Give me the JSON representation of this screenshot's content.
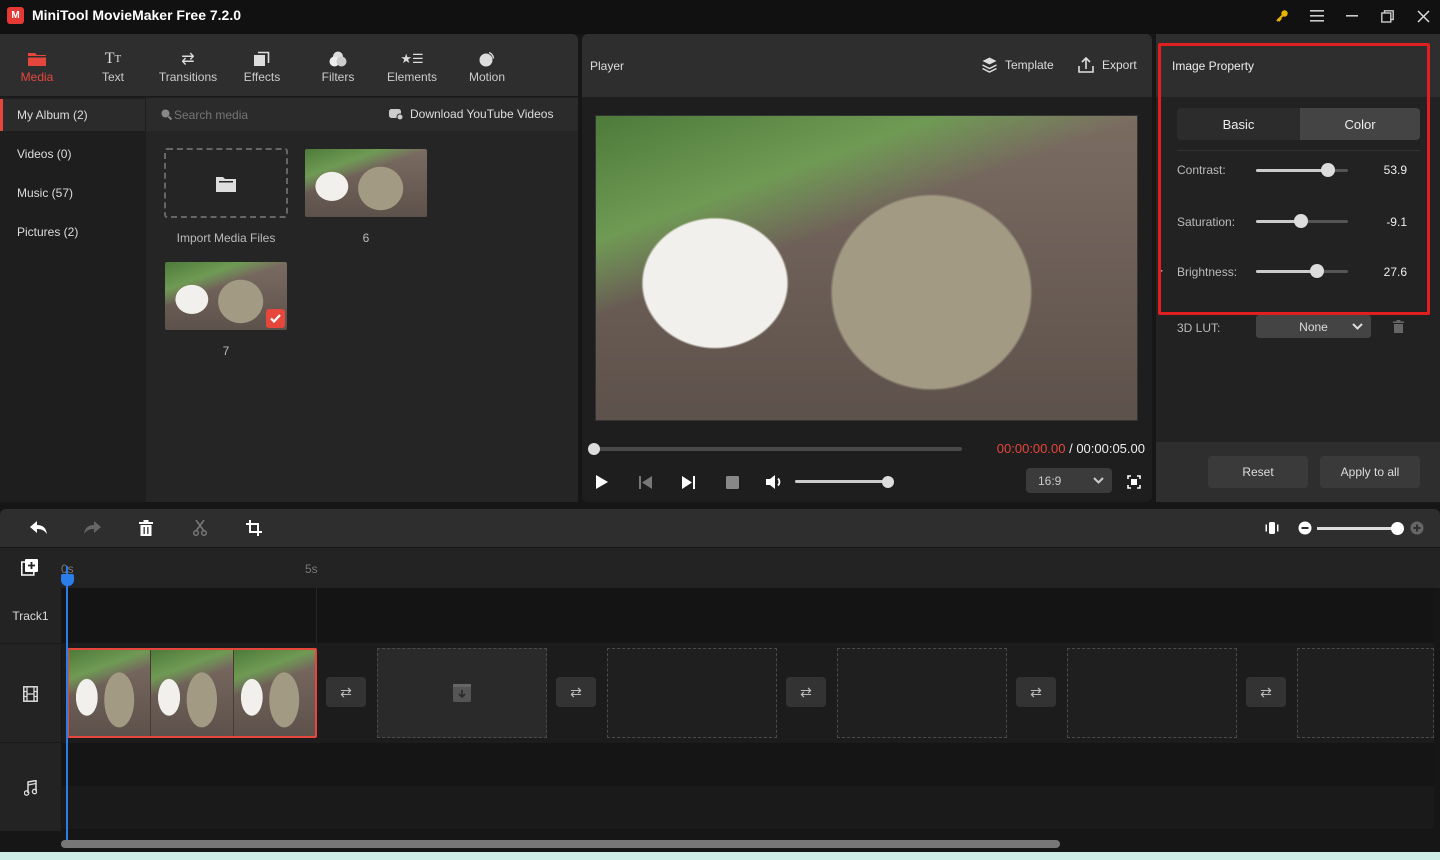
{
  "app": {
    "title": "MiniTool MovieMaker Free 7.2.0",
    "logo_glyph": "M",
    "window_controls": [
      {
        "name": "key-icon",
        "glyph": "🔑"
      },
      {
        "name": "menu-icon",
        "glyph": "☰"
      },
      {
        "name": "minimize-icon",
        "glyph": "—"
      },
      {
        "name": "restore-icon",
        "glyph": "❐"
      },
      {
        "name": "close-icon",
        "glyph": "✕"
      }
    ]
  },
  "toolbar": {
    "tabs": [
      {
        "label": "Media",
        "icon": "folder-icon",
        "active": true
      },
      {
        "label": "Text",
        "icon": "text-icon"
      },
      {
        "label": "Transitions",
        "icon": "transitions-icon"
      },
      {
        "label": "Effects",
        "icon": "effects-icon"
      },
      {
        "label": "Filters",
        "icon": "filters-icon"
      },
      {
        "label": "Elements",
        "icon": "elements-icon"
      },
      {
        "label": "Motion",
        "icon": "motion-icon"
      }
    ]
  },
  "album": {
    "items": [
      {
        "label": "My Album (2)",
        "active": true
      },
      {
        "label": "Videos (0)"
      },
      {
        "label": "Music (57)"
      },
      {
        "label": "Pictures (2)"
      }
    ]
  },
  "media": {
    "search_placeholder": "Search media",
    "download_label": "Download YouTube Videos",
    "import_label": "Import Media Files",
    "items": [
      {
        "caption": "6",
        "selected": false
      },
      {
        "caption": "7",
        "selected": true
      }
    ]
  },
  "player": {
    "title": "Player",
    "template_label": "Template",
    "export_label": "Export",
    "current_time": "00:00:00.00",
    "separator": " / ",
    "total_time": "00:00:05.00",
    "progress": 0.0,
    "volume": 1.0,
    "aspect_ratio": "16:9"
  },
  "property": {
    "title": "Image Property",
    "tabs": [
      {
        "label": "Basic",
        "active": false
      },
      {
        "label": "Color",
        "active": true
      }
    ],
    "adjustments": [
      {
        "label": "Contrast:",
        "value": "53.9",
        "fraction": 0.78
      },
      {
        "label": "Saturation:",
        "value": "-9.1",
        "fraction": 0.49
      },
      {
        "label": "Brightness:",
        "value": "27.6",
        "fraction": 0.66
      }
    ],
    "lut_label": "3D LUT:",
    "lut_value": "None",
    "reset_label": "Reset",
    "apply_all_label": "Apply to all"
  },
  "timeline": {
    "ruler": [
      "0s",
      "5s"
    ],
    "track_label": "Track1",
    "zoom_level": 1.0,
    "clip_count": 1,
    "empty_slots": 5
  },
  "colors": {
    "accent": "#e5473c",
    "playhead": "#2b7de9",
    "highlight_frame": "#e02020",
    "time_current": "#e5473c"
  }
}
